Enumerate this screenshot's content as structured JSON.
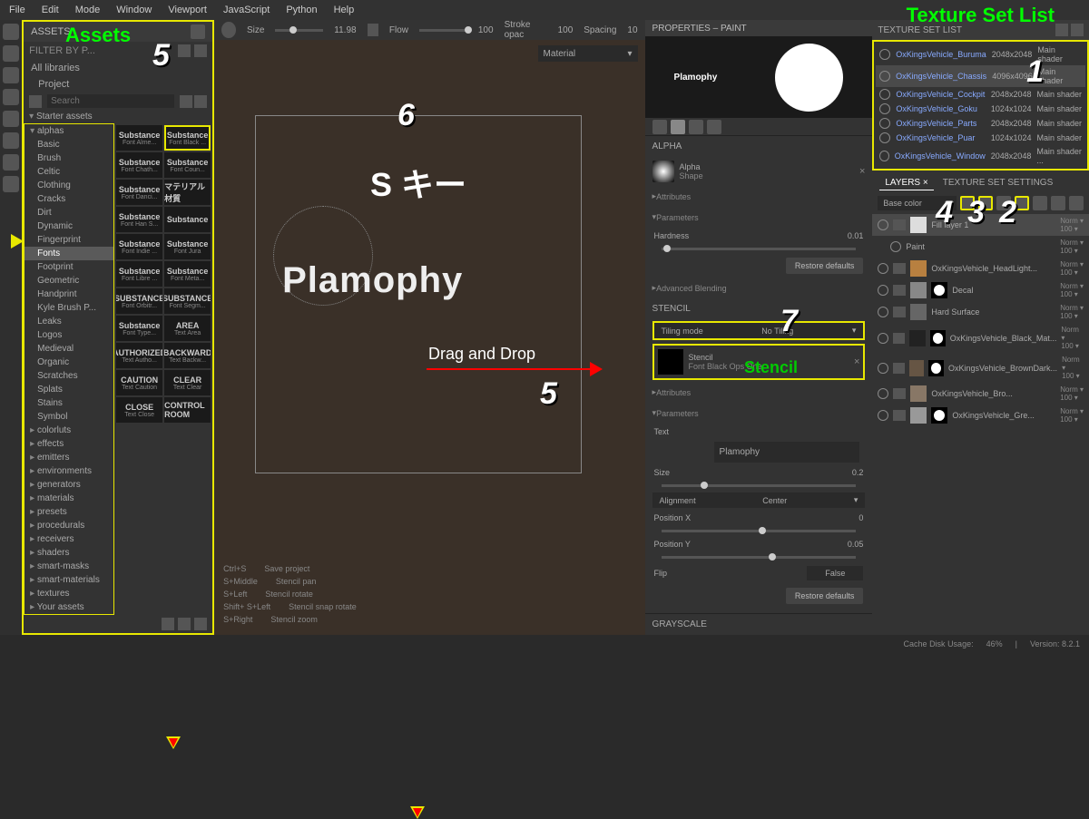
{
  "menu": [
    "File",
    "Edit",
    "Mode",
    "Window",
    "Viewport",
    "JavaScript",
    "Python",
    "Help"
  ],
  "assets": {
    "title": "ASSETS",
    "filter_placeholder": "FILTER BY P...",
    "all_lib": "All libraries",
    "project": "Project",
    "starter": "Starter assets",
    "search_placeholder": "Search",
    "categories_alpha": [
      "alphas",
      "Basic",
      "Brush",
      "Celtic",
      "Clothing",
      "Cracks",
      "Dirt",
      "Dynamic",
      "Fingerprint",
      "Fonts",
      "Footprint",
      "Geometric",
      "Handprint",
      "Kyle Brush P...",
      "Leaks",
      "Logos",
      "Medieval",
      "Organic",
      "Scratches",
      "Splats",
      "Stains",
      "Symbol"
    ],
    "categories_after": [
      "colorluts",
      "effects",
      "emitters",
      "environments",
      "generators",
      "materials",
      "presets",
      "procedurals",
      "receivers",
      "shaders",
      "smart-masks",
      "smart-materials",
      "textures",
      "Your assets"
    ],
    "fonts": [
      {
        "prev": "Substance",
        "nm": "Font Alme..."
      },
      {
        "prev": "Substance",
        "nm": "Font Black ..."
      },
      {
        "prev": "Substance",
        "nm": "Font Chath..."
      },
      {
        "prev": "Substance",
        "nm": "Font Coun..."
      },
      {
        "prev": "Substance",
        "nm": "Font Danci..."
      },
      {
        "prev": "マテリアル 材質",
        "nm": ""
      },
      {
        "prev": "Substance",
        "nm": "Font Han S..."
      },
      {
        "prev": "Substance",
        "nm": ""
      },
      {
        "prev": "Substance",
        "nm": "Font Indie ..."
      },
      {
        "prev": "Substance",
        "nm": "Font Jura"
      },
      {
        "prev": "Substance",
        "nm": "Font Libre ..."
      },
      {
        "prev": "Substance",
        "nm": "Font Meta..."
      },
      {
        "prev": "SUBSTANCE",
        "nm": "Font Orbitr..."
      },
      {
        "prev": "SUBSTANCE",
        "nm": "Font Segm..."
      },
      {
        "prev": "Substance",
        "nm": "Font Type..."
      },
      {
        "prev": "AREA",
        "nm": "Text Area"
      },
      {
        "prev": "AUTHORIZED",
        "nm": "Text Autho..."
      },
      {
        "prev": "BACKWARD",
        "nm": "Text Backw..."
      },
      {
        "prev": "CAUTION",
        "nm": "Text Caution"
      },
      {
        "prev": "CLEAR",
        "nm": "Text Clear"
      },
      {
        "prev": "CLOSE",
        "nm": "Text Close"
      },
      {
        "prev": "CONTROL ROOM",
        "nm": ""
      }
    ]
  },
  "viewport": {
    "size_label": "Size",
    "size_val": "11.98",
    "flow_label": "Flow",
    "flow_val": "100",
    "stroke_label": "Stroke opac",
    "stroke_val": "100",
    "spacing_label": "Spacing",
    "spacing_val": "10",
    "material": "Material",
    "text": "Plamophy",
    "hints": [
      [
        "Ctrl+S",
        "Save project"
      ],
      [
        "S+Middle",
        "Stencil pan"
      ],
      [
        "S+Left",
        "Stencil rotate"
      ],
      [
        "Shift+ S+Left",
        "Stencil snap rotate"
      ],
      [
        "S+Right",
        "Stencil zoom"
      ]
    ]
  },
  "props": {
    "title": "PROPERTIES – PAINT",
    "preview_text": "Plamophy",
    "alpha_hdr": "ALPHA",
    "alpha_name": "Alpha",
    "alpha_shape": "Shape",
    "attributes": "Attributes",
    "parameters": "Parameters",
    "hardness": "Hardness",
    "hardness_val": "0.01",
    "restore": "Restore defaults",
    "adv_blend": "Advanced Blending",
    "stencil_hdr": "STENCIL",
    "tiling_label": "Tiling mode",
    "tiling_val": "No Tiling",
    "stencil_name": "Stencil",
    "stencil_font": "Font Black Ops One",
    "text_param": "Text",
    "text_val": "Plamophy",
    "size_param": "Size",
    "size_val": "0.2",
    "align_param": "Alignment",
    "align_val": "Center",
    "posx": "Position X",
    "posx_val": "0",
    "posy": "Position Y",
    "posy_val": "0.05",
    "flip": "Flip",
    "flip_val": "False",
    "grayscale": "GRAYSCALE"
  },
  "tsl": {
    "title": "TEXTURE SET LIST",
    "rows": [
      {
        "nm": "OxKingsVehicle_Buruma",
        "res": "2048x2048",
        "sh": "Main shader"
      },
      {
        "nm": "OxKingsVehicle_Chassis",
        "res": "4096x4096",
        "sh": "Main shader"
      },
      {
        "nm": "OxKingsVehicle_Cockpit",
        "res": "2048x2048",
        "sh": "Main shader"
      },
      {
        "nm": "OxKingsVehicle_Goku",
        "res": "1024x1024",
        "sh": "Main shader"
      },
      {
        "nm": "OxKingsVehicle_Parts",
        "res": "2048x2048",
        "sh": "Main shader"
      },
      {
        "nm": "OxKingsVehicle_Puar",
        "res": "1024x1024",
        "sh": "Main shader"
      },
      {
        "nm": "OxKingsVehicle_Window",
        "res": "2048x2048",
        "sh": "Main shader ..."
      }
    ]
  },
  "layers": {
    "tab1": "LAYERS",
    "tab2": "TEXTURE SET SETTINGS",
    "base": "Base color",
    "rows": [
      {
        "nm": "Fill layer 1",
        "blend": "Norm",
        "op": "100",
        "sel": true,
        "sw": "#ddd"
      },
      {
        "sub": true,
        "nm": "Paint",
        "blend": "Norm",
        "op": "100"
      },
      {
        "nm": "OxKingsVehicle_HeadLight...",
        "blend": "Norm",
        "op": "100",
        "sw": "#b88040"
      },
      {
        "nm": "Decal",
        "blend": "Norm",
        "op": "100",
        "mask": true,
        "sw": "#888"
      },
      {
        "nm": "Hard Surface",
        "blend": "Norm",
        "op": "100",
        "sw": "#666"
      },
      {
        "nm": "OxKingsVehicle_Black_Mat...",
        "blend": "Norm",
        "op": "100",
        "mask": true,
        "sw": "#222"
      },
      {
        "nm": "OxKingsVehicle_BrownDark...",
        "blend": "Norm",
        "op": "100",
        "mask": true,
        "sw": "#654"
      },
      {
        "nm": "OxKingsVehicle_Bro...",
        "blend": "Norm",
        "op": "100",
        "sw": "#876"
      },
      {
        "nm": "OxKingsVehicle_Gre...",
        "blend": "Norm",
        "op": "100",
        "mask": true,
        "sw": "#999"
      }
    ]
  },
  "status": {
    "cache": "Cache Disk Usage:",
    "cache_val": "46%",
    "ver": "Version: 8.2.1"
  },
  "ann": {
    "assets": "Assets",
    "tsl": "Texture Set List",
    "stencil": "Stencil",
    "skey": "S キー",
    "dragdrop": "Drag and Drop"
  }
}
